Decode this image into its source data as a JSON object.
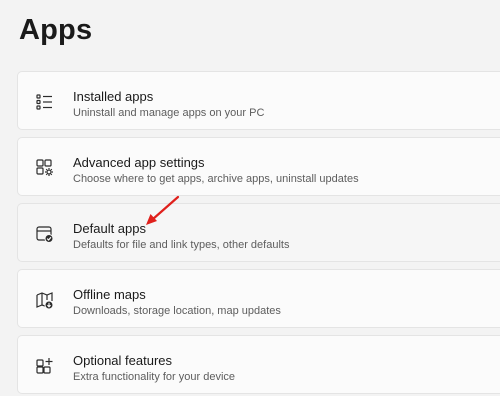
{
  "page": {
    "title": "Apps"
  },
  "items": [
    {
      "title": "Installed apps",
      "subtitle": "Uninstall and manage apps on your PC",
      "icon": "list-icon"
    },
    {
      "title": "Advanced app settings",
      "subtitle": "Choose where to get apps, archive apps, uninstall updates",
      "icon": "app-settings-icon"
    },
    {
      "title": "Default apps",
      "subtitle": "Defaults for file and link types, other defaults",
      "icon": "default-apps-icon"
    },
    {
      "title": "Offline maps",
      "subtitle": "Downloads, storage location, map updates",
      "icon": "offline-map-icon"
    },
    {
      "title": "Optional features",
      "subtitle": "Extra functionality for your device",
      "icon": "optional-features-icon"
    }
  ],
  "annotation": {
    "arrow_color": "#e0201c"
  }
}
